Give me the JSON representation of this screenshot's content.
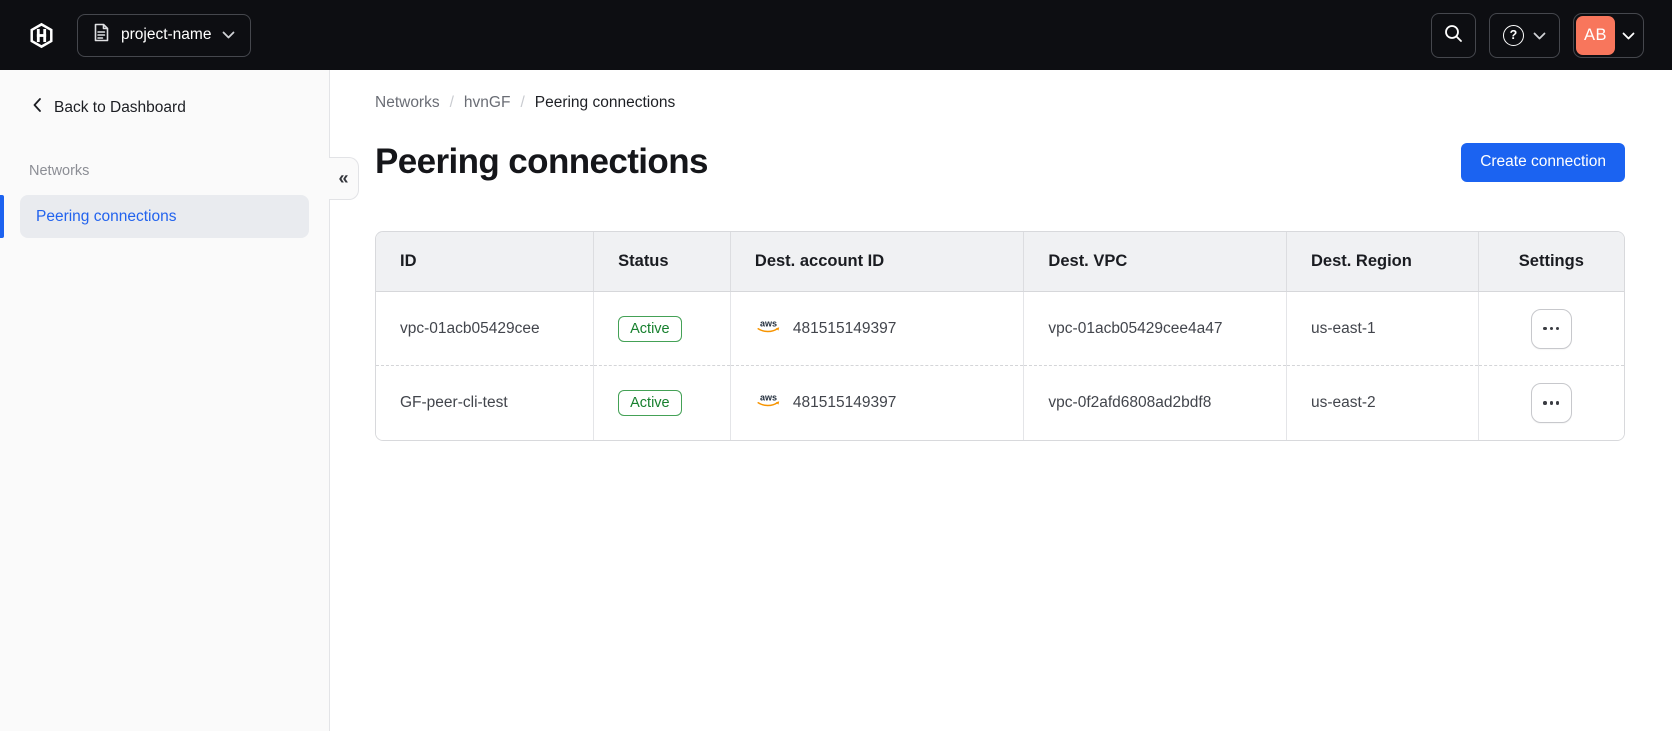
{
  "navbar": {
    "project_name": "project-name",
    "avatar_initials": "AB"
  },
  "icons": {
    "collapse_glyph": "«",
    "help_glyph": "?",
    "aws_label": "aws"
  },
  "sidebar": {
    "back_label": "Back to Dashboard",
    "section_label": "Networks",
    "active_item": "Peering connections"
  },
  "breadcrumb": {
    "separator": "/",
    "items": [
      "Networks",
      "hvnGF",
      "Peering connections"
    ]
  },
  "page": {
    "title": "Peering connections",
    "create_button_label": "Create connection"
  },
  "table": {
    "columns": [
      "ID",
      "Status",
      "Dest. account ID",
      "Dest. VPC",
      "Dest. Region",
      "Settings"
    ],
    "rows": [
      {
        "id": "vpc-01acb05429cee",
        "status": "Active",
        "dest_account_id": "481515149397",
        "dest_vpc": "vpc-01acb05429cee4a47",
        "dest_region": "us-east-1"
      },
      {
        "id": "GF-peer-cli-test",
        "status": "Active",
        "dest_account_id": "481515149397",
        "dest_vpc": "vpc-0f2afd6808ad2bdf8",
        "dest_region": "us-east-2"
      }
    ]
  },
  "colors": {
    "navbar_bg": "#0d0e12",
    "accent_blue": "#1b63f1",
    "sidebar_active_blue": "#2263ee",
    "avatar_coral": "#f8765c",
    "badge_green_border": "#44a156",
    "badge_green_text": "#17802e",
    "aws_orange": "#f79400"
  }
}
